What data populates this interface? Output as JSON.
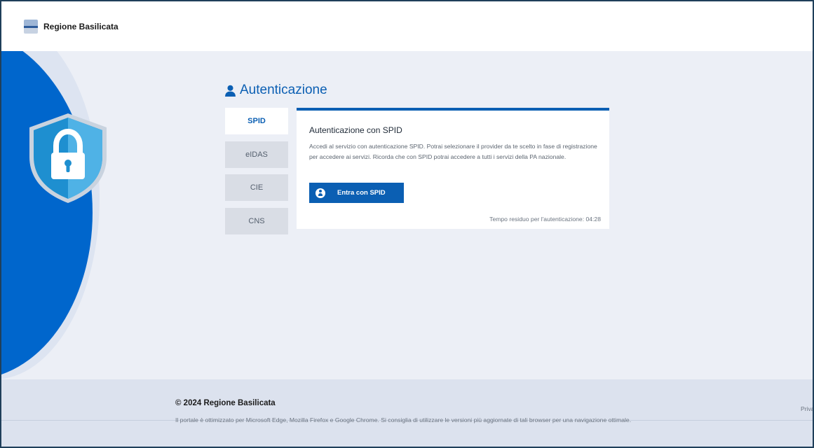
{
  "header": {
    "brand": "Regione Basilicata",
    "logo_icon": "regione-basilicata-logo"
  },
  "decor": {
    "shield_icon": "shield-padlock-icon",
    "colors": {
      "blue": "#0066cc",
      "shield": "#2d9bd7",
      "accent": "#0b5fb3"
    }
  },
  "main": {
    "title": "Autenticazione",
    "title_icon": "user-icon",
    "tabs": [
      {
        "label": "SPID",
        "active": true
      },
      {
        "label": "eIDAS",
        "active": false
      },
      {
        "label": "CIE",
        "active": false
      },
      {
        "label": "CNS",
        "active": false
      }
    ],
    "panel": {
      "heading": "Autenticazione con SPID",
      "description": "Accedi al servizio con autenticazione SPID. Potrai selezionare il provider da te scelto in fase di registrazione per accedere ai servizi. Ricorda che con SPID potrai accedere a tutti i servizi della PA nazionale.",
      "button_label": "Entra con SPID",
      "button_icon": "spid-user-icon",
      "timer_text": "Tempo residuo per l'autenticazione: 04:28"
    }
  },
  "footer": {
    "copyright": "© 2024 Regione Basilicata",
    "note": "Il portale è ottimizzato per Microsoft Edge, Mozilla Firefox e Google Chrome. Si consiglia di utilizzare le versioni più aggiornate di tali browser per una navigazione ottimale.",
    "privacy_link": "Priva"
  }
}
